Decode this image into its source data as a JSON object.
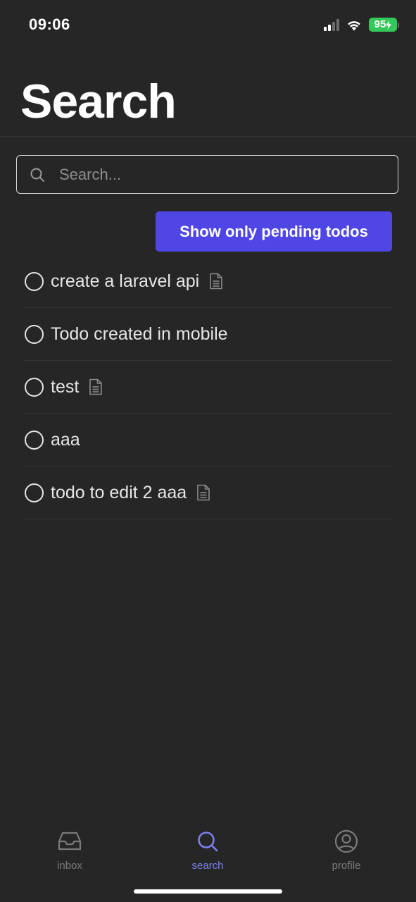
{
  "status_bar": {
    "time": "09:06",
    "battery": "95",
    "battery_color": "#34c759"
  },
  "header": {
    "title": "Search"
  },
  "search": {
    "placeholder": "Search...",
    "value": "",
    "icon": "search-icon"
  },
  "filter_button": {
    "label": "Show only pending todos",
    "color": "#4f46e5"
  },
  "todos": [
    {
      "label": "create a laravel api",
      "has_note": true,
      "done": false
    },
    {
      "label": "Todo created in mobile",
      "has_note": false,
      "done": false
    },
    {
      "label": "test",
      "has_note": true,
      "done": false
    },
    {
      "label": "aaa",
      "has_note": false,
      "done": false
    },
    {
      "label": "todo to edit 2 aaa",
      "has_note": true,
      "done": false
    }
  ],
  "tabs": [
    {
      "label": "inbox",
      "icon": "inbox-icon",
      "active": false
    },
    {
      "label": "search",
      "icon": "search-icon",
      "active": true
    },
    {
      "label": "profile",
      "icon": "user-circle-icon",
      "active": false
    }
  ],
  "colors": {
    "background": "#262626",
    "active_tab": "#7b80ee",
    "inactive_tab": "#7a7a7a"
  }
}
